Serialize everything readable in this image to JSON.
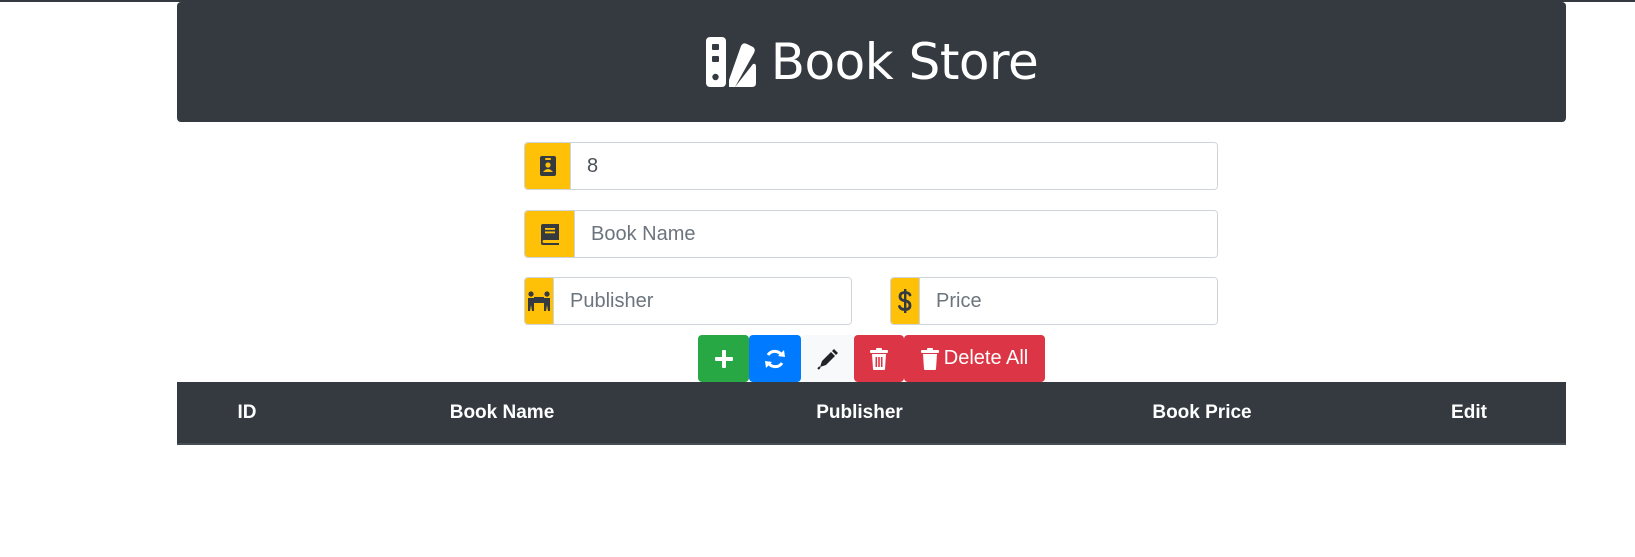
{
  "header": {
    "title": "Book Store",
    "logo_icon": "swatchbook-icon"
  },
  "form": {
    "id": {
      "value": "8",
      "icon": "id-badge-icon"
    },
    "book_name": {
      "placeholder": "Book Name",
      "value": "",
      "icon": "book-icon"
    },
    "publisher": {
      "placeholder": "Publisher",
      "value": "",
      "icon": "people-carry-icon"
    },
    "price": {
      "placeholder": "Price",
      "value": "",
      "icon": "dollar-icon"
    }
  },
  "buttons": {
    "add": {
      "icon": "plus-icon"
    },
    "refresh": {
      "icon": "sync-icon"
    },
    "edit": {
      "icon": "pen-icon"
    },
    "delete": {
      "icon": "trash-icon"
    },
    "delete_all": {
      "label": "Delete All",
      "icon": "trash-icon"
    }
  },
  "table": {
    "columns": [
      "ID",
      "Book Name",
      "Publisher",
      "Book Price",
      "Edit"
    ],
    "rows": []
  },
  "colors": {
    "header_bg": "#343a40",
    "addon_bg": "#ffc107",
    "add_btn": "#28a745",
    "refresh_btn": "#007bff",
    "edit_btn": "#f8f9fa",
    "delete_btn": "#dc3545"
  }
}
